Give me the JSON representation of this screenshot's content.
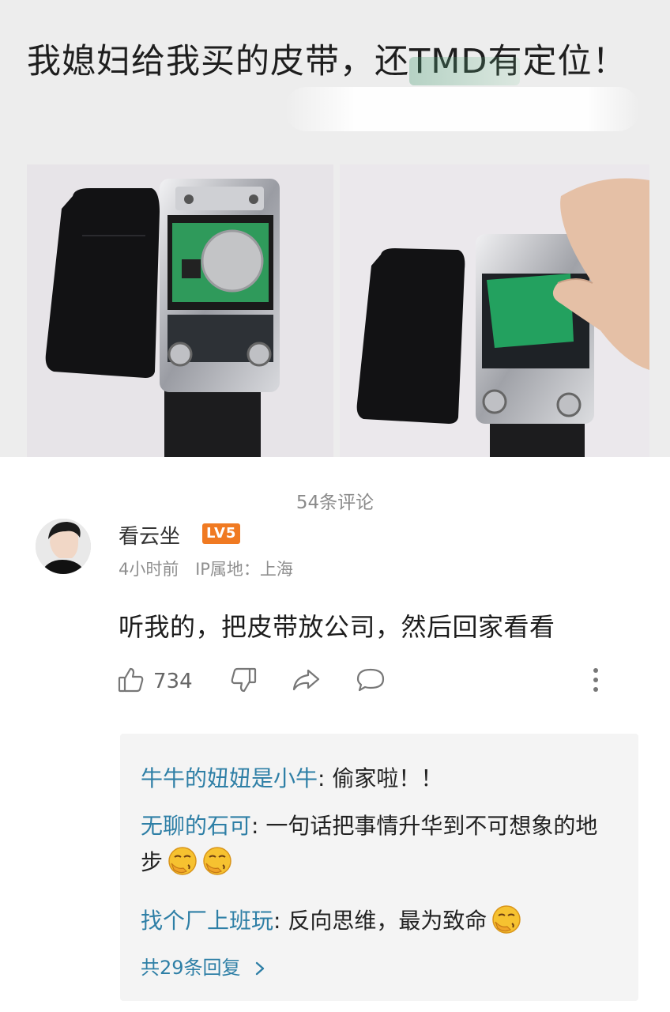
{
  "post": {
    "title": "我媳妇给我买的皮带，还TMD有定位！"
  },
  "comments_header": {
    "count_label": "54条评论"
  },
  "comment": {
    "username": "看云坐",
    "level": "LV5",
    "time": "4小时前",
    "ip_location": "IP属地：上海",
    "text": "听我的，把皮带放公司，然后回家看看",
    "likes": "734"
  },
  "replies": [
    {
      "name": "牛牛的妞妞是小牛",
      "text": ": 偷家啦！！",
      "emoji_count": 0
    },
    {
      "name": "无聊的石可",
      "text": ": 一句话把事情升华到不可想象的地步",
      "emoji_count": 2
    },
    {
      "name": "找个厂上班玩",
      "text": ": 反向思维，最为致命",
      "emoji_count": 1
    }
  ],
  "more_replies_label": "共29条回复",
  "icons": {
    "like": "thumbs-up-icon",
    "dislike": "thumbs-down-icon",
    "share": "share-icon",
    "reply": "comment-bubble-icon",
    "more": "more-vertical-icon",
    "emoji": "laughing-cover-mouth-emoji"
  },
  "colors": {
    "reply_name": "#2e7fa6",
    "level_badge": "#f07a22",
    "reply_background": "#f4f4f4"
  }
}
